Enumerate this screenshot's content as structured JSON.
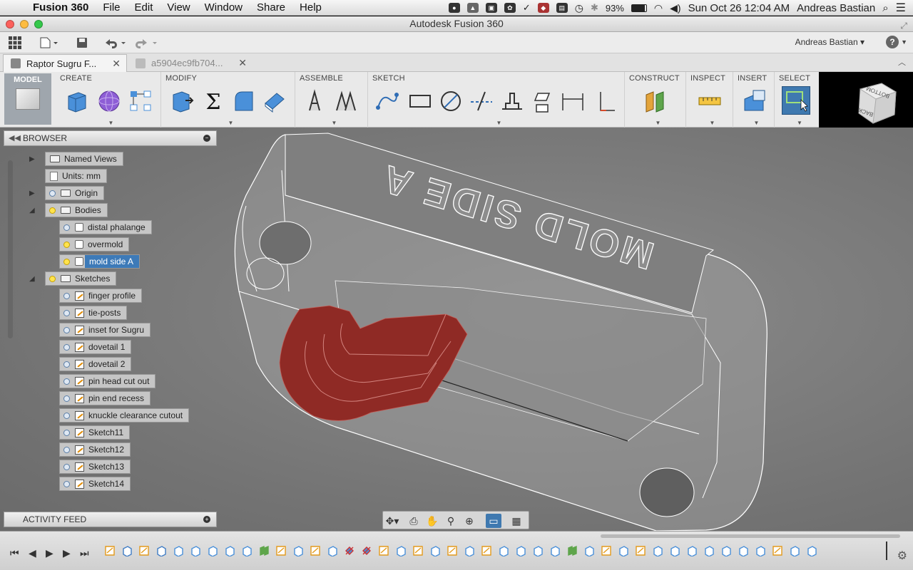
{
  "menubar": {
    "app": "Fusion 360",
    "items": [
      "File",
      "Edit",
      "View",
      "Window",
      "Share",
      "Help"
    ],
    "battery": "93%",
    "datetime": "Sun Oct 26  12:04 AM",
    "user": "Andreas Bastian"
  },
  "window": {
    "title": "Autodesk Fusion 360"
  },
  "toolbar": {
    "user": "Andreas Bastian ▾",
    "help": "?"
  },
  "tabs": [
    {
      "label": "Raptor Sugru F..."
    },
    {
      "label": "a5904ec9fb704..."
    }
  ],
  "ribbon": {
    "workspace": "MODEL",
    "groups": [
      "CREATE",
      "MODIFY",
      "ASSEMBLE",
      "SKETCH",
      "CONSTRUCT",
      "INSPECT",
      "INSERT",
      "SELECT"
    ]
  },
  "viewcube": {
    "face_top": "BOTTOM",
    "face_side": "BACK"
  },
  "model": {
    "engraved_text": "MOLD SIDE A"
  },
  "browser": {
    "title": "BROWSER",
    "nodes": [
      {
        "label": "Named Views"
      },
      {
        "label": "Units: mm"
      },
      {
        "label": "Origin"
      },
      {
        "label": "Bodies"
      },
      {
        "label": "distal phalange"
      },
      {
        "label": "overmold"
      },
      {
        "label": "mold side A"
      },
      {
        "label": "Sketches"
      },
      {
        "label": "finger profile"
      },
      {
        "label": "tie-posts"
      },
      {
        "label": "inset for Sugru"
      },
      {
        "label": "dovetail 1"
      },
      {
        "label": "dovetail 2"
      },
      {
        "label": "pin head cut out"
      },
      {
        "label": "pin end recess"
      },
      {
        "label": "knuckle clearance cutout"
      },
      {
        "label": "Sketch11"
      },
      {
        "label": "Sketch12"
      },
      {
        "label": "Sketch13"
      },
      {
        "label": "Sketch14"
      }
    ]
  },
  "activity": {
    "title": "ACTIVITY FEED"
  },
  "colors": {
    "accent": "#3d7ab8",
    "highlight_body": "#8f2a25",
    "viewport": "#7d7d7d"
  }
}
